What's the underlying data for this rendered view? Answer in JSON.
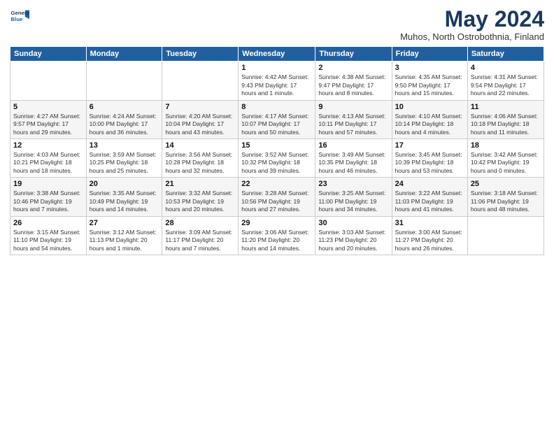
{
  "logo": {
    "line1": "General",
    "line2": "Blue"
  },
  "title": "May 2024",
  "subtitle": "Muhos, North Ostrobothnia, Finland",
  "weekdays": [
    "Sunday",
    "Monday",
    "Tuesday",
    "Wednesday",
    "Thursday",
    "Friday",
    "Saturday"
  ],
  "weeks": [
    [
      {
        "day": "",
        "info": ""
      },
      {
        "day": "",
        "info": ""
      },
      {
        "day": "",
        "info": ""
      },
      {
        "day": "1",
        "info": "Sunrise: 4:42 AM\nSunset: 9:43 PM\nDaylight: 17 hours\nand 1 minute."
      },
      {
        "day": "2",
        "info": "Sunrise: 4:38 AM\nSunset: 9:47 PM\nDaylight: 17 hours\nand 8 minutes."
      },
      {
        "day": "3",
        "info": "Sunrise: 4:35 AM\nSunset: 9:50 PM\nDaylight: 17 hours\nand 15 minutes."
      },
      {
        "day": "4",
        "info": "Sunrise: 4:31 AM\nSunset: 9:54 PM\nDaylight: 17 hours\nand 22 minutes."
      }
    ],
    [
      {
        "day": "5",
        "info": "Sunrise: 4:27 AM\nSunset: 9:57 PM\nDaylight: 17 hours\nand 29 minutes."
      },
      {
        "day": "6",
        "info": "Sunrise: 4:24 AM\nSunset: 10:00 PM\nDaylight: 17 hours\nand 36 minutes."
      },
      {
        "day": "7",
        "info": "Sunrise: 4:20 AM\nSunset: 10:04 PM\nDaylight: 17 hours\nand 43 minutes."
      },
      {
        "day": "8",
        "info": "Sunrise: 4:17 AM\nSunset: 10:07 PM\nDaylight: 17 hours\nand 50 minutes."
      },
      {
        "day": "9",
        "info": "Sunrise: 4:13 AM\nSunset: 10:11 PM\nDaylight: 17 hours\nand 57 minutes."
      },
      {
        "day": "10",
        "info": "Sunrise: 4:10 AM\nSunset: 10:14 PM\nDaylight: 18 hours\nand 4 minutes."
      },
      {
        "day": "11",
        "info": "Sunrise: 4:06 AM\nSunset: 10:18 PM\nDaylight: 18 hours\nand 11 minutes."
      }
    ],
    [
      {
        "day": "12",
        "info": "Sunrise: 4:03 AM\nSunset: 10:21 PM\nDaylight: 18 hours\nand 18 minutes."
      },
      {
        "day": "13",
        "info": "Sunrise: 3:59 AM\nSunset: 10:25 PM\nDaylight: 18 hours\nand 25 minutes."
      },
      {
        "day": "14",
        "info": "Sunrise: 3:56 AM\nSunset: 10:28 PM\nDaylight: 18 hours\nand 32 minutes."
      },
      {
        "day": "15",
        "info": "Sunrise: 3:52 AM\nSunset: 10:32 PM\nDaylight: 18 hours\nand 39 minutes."
      },
      {
        "day": "16",
        "info": "Sunrise: 3:49 AM\nSunset: 10:35 PM\nDaylight: 18 hours\nand 46 minutes."
      },
      {
        "day": "17",
        "info": "Sunrise: 3:45 AM\nSunset: 10:39 PM\nDaylight: 18 hours\nand 53 minutes."
      },
      {
        "day": "18",
        "info": "Sunrise: 3:42 AM\nSunset: 10:42 PM\nDaylight: 19 hours\nand 0 minutes."
      }
    ],
    [
      {
        "day": "19",
        "info": "Sunrise: 3:38 AM\nSunset: 10:46 PM\nDaylight: 19 hours\nand 7 minutes."
      },
      {
        "day": "20",
        "info": "Sunrise: 3:35 AM\nSunset: 10:49 PM\nDaylight: 19 hours\nand 14 minutes."
      },
      {
        "day": "21",
        "info": "Sunrise: 3:32 AM\nSunset: 10:53 PM\nDaylight: 19 hours\nand 20 minutes."
      },
      {
        "day": "22",
        "info": "Sunrise: 3:28 AM\nSunset: 10:56 PM\nDaylight: 19 hours\nand 27 minutes."
      },
      {
        "day": "23",
        "info": "Sunrise: 3:25 AM\nSunset: 11:00 PM\nDaylight: 19 hours\nand 34 minutes."
      },
      {
        "day": "24",
        "info": "Sunrise: 3:22 AM\nSunset: 11:03 PM\nDaylight: 19 hours\nand 41 minutes."
      },
      {
        "day": "25",
        "info": "Sunrise: 3:18 AM\nSunset: 11:06 PM\nDaylight: 19 hours\nand 48 minutes."
      }
    ],
    [
      {
        "day": "26",
        "info": "Sunrise: 3:15 AM\nSunset: 11:10 PM\nDaylight: 19 hours\nand 54 minutes."
      },
      {
        "day": "27",
        "info": "Sunrise: 3:12 AM\nSunset: 11:13 PM\nDaylight: 20 hours\nand 1 minute."
      },
      {
        "day": "28",
        "info": "Sunrise: 3:09 AM\nSunset: 11:17 PM\nDaylight: 20 hours\nand 7 minutes."
      },
      {
        "day": "29",
        "info": "Sunrise: 3:06 AM\nSunset: 11:20 PM\nDaylight: 20 hours\nand 14 minutes."
      },
      {
        "day": "30",
        "info": "Sunrise: 3:03 AM\nSunset: 11:23 PM\nDaylight: 20 hours\nand 20 minutes."
      },
      {
        "day": "31",
        "info": "Sunrise: 3:00 AM\nSunset: 11:27 PM\nDaylight: 20 hours\nand 26 minutes."
      },
      {
        "day": "",
        "info": ""
      }
    ]
  ]
}
